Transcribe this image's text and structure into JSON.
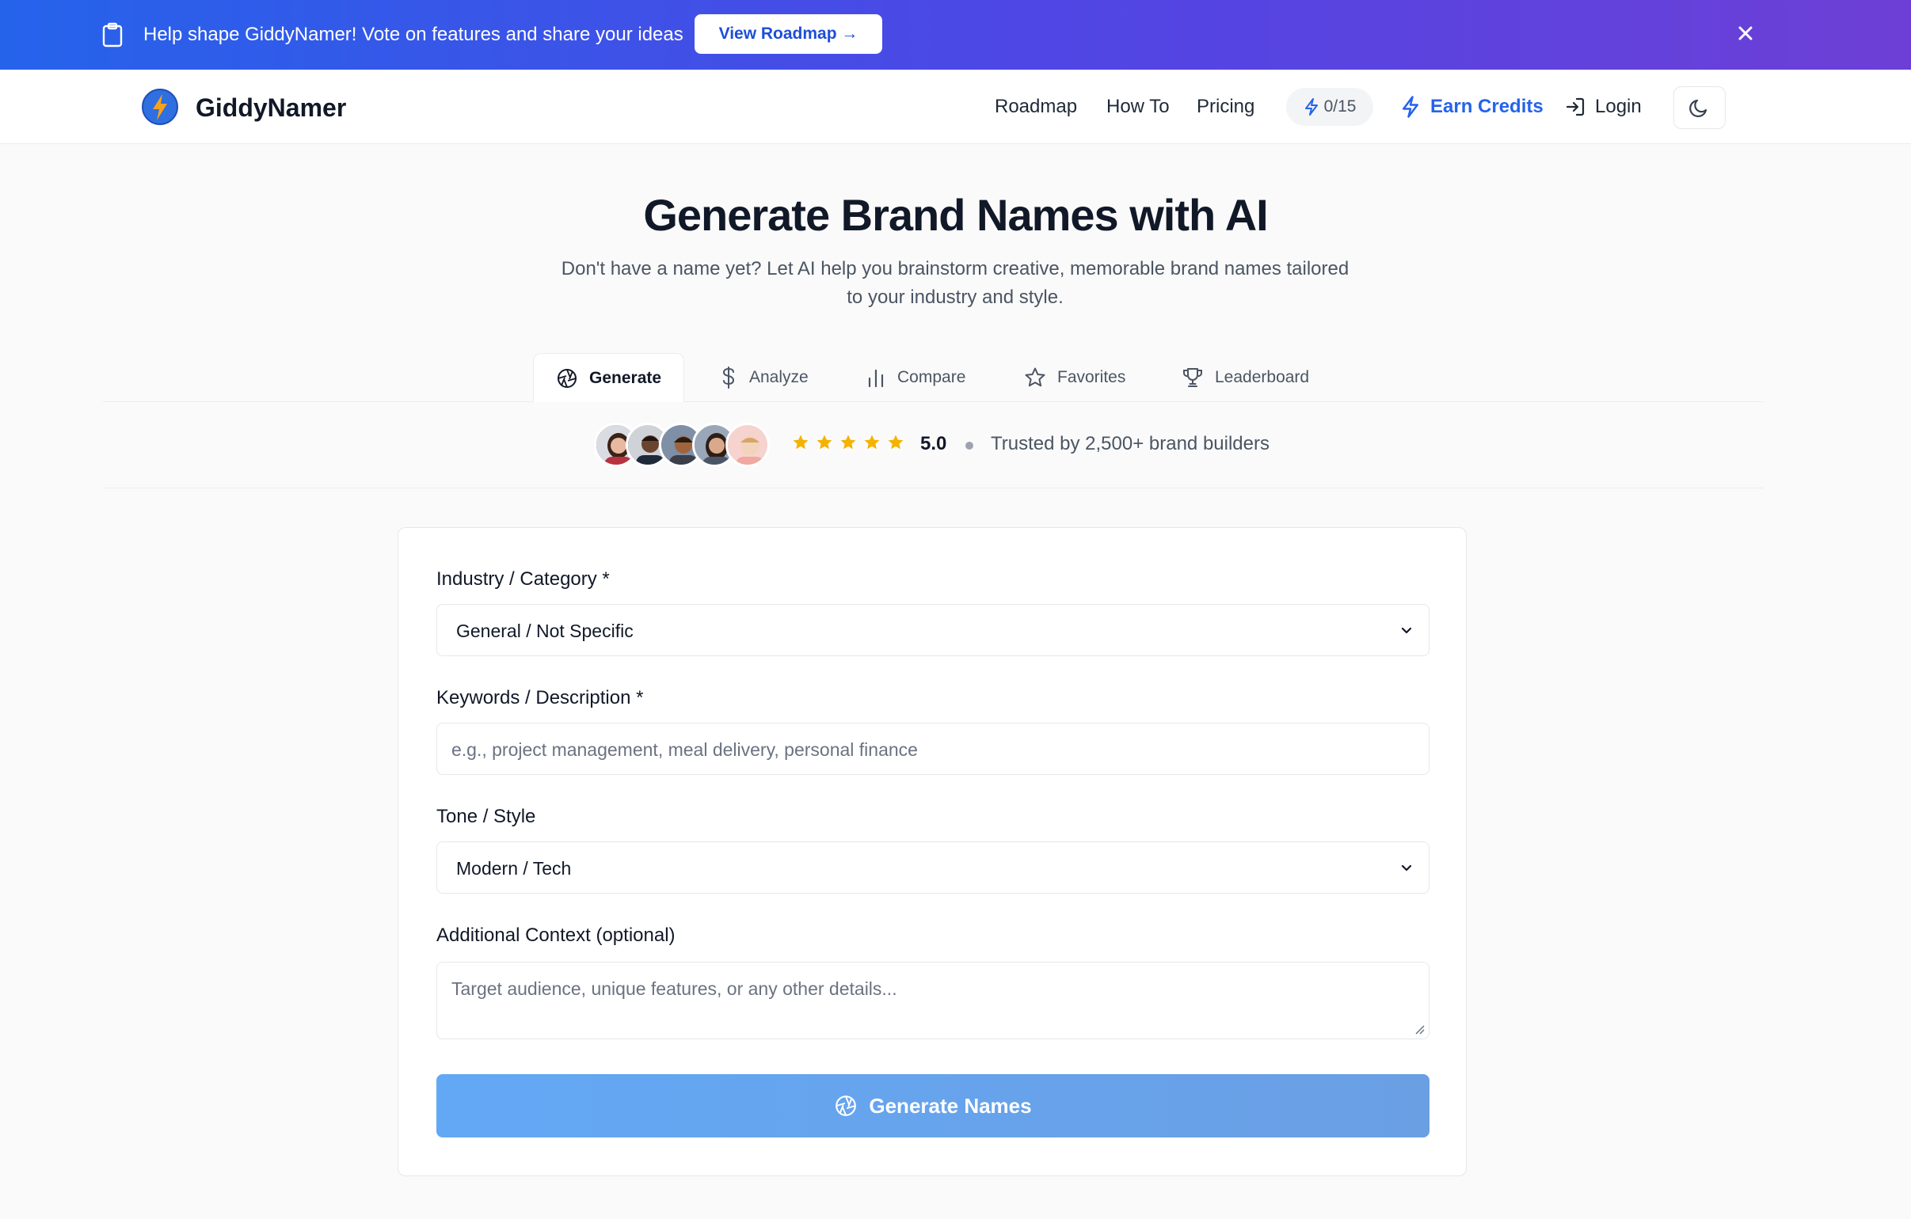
{
  "banner": {
    "text": "Help shape GiddyNamer! Vote on features and share your ideas",
    "button_label": "View Roadmap →",
    "icon": "clipboard-icon",
    "close_icon": "close-icon"
  },
  "header": {
    "brand": "GiddyNamer",
    "nav": [
      "Roadmap",
      "How To",
      "Pricing"
    ],
    "credits": "0/15",
    "earn_credits": "Earn Credits",
    "login": "Login",
    "theme_icon": "moon-icon"
  },
  "hero": {
    "title": "Generate Brand Names with AI",
    "subtitle": "Don't have a name yet? Let AI help you brainstorm creative, memorable brand names tailored to your industry and style."
  },
  "tabs": [
    {
      "label": "Generate",
      "icon": "aperture-icon",
      "active": true
    },
    {
      "label": "Analyze",
      "icon": "dollar-icon",
      "active": false
    },
    {
      "label": "Compare",
      "icon": "bar-chart-icon",
      "active": false
    },
    {
      "label": "Favorites",
      "icon": "star-outline-icon",
      "active": false
    },
    {
      "label": "Leaderboard",
      "icon": "trophy-icon",
      "active": false
    }
  ],
  "social_proof": {
    "rating": "5.0",
    "stars": 5,
    "trusted_text": "Trusted by 2,500+ brand builders"
  },
  "form": {
    "industry": {
      "label": "Industry / Category *",
      "value": "General / Not Specific"
    },
    "keywords": {
      "label": "Keywords / Description *",
      "placeholder": "e.g., project management, meal delivery, personal finance"
    },
    "tone": {
      "label": "Tone / Style",
      "value": "Modern / Tech"
    },
    "context": {
      "label": "Additional Context (optional)",
      "placeholder": "Target audience, unique features, or any other details..."
    },
    "submit_label": "Generate Names"
  },
  "colors": {
    "brand_blue": "#2563eb",
    "banner_gradient_start": "#2563eb",
    "banner_gradient_end": "#6d3fd6",
    "star_yellow": "#f5b301",
    "button_blue": "#63a8f5"
  }
}
